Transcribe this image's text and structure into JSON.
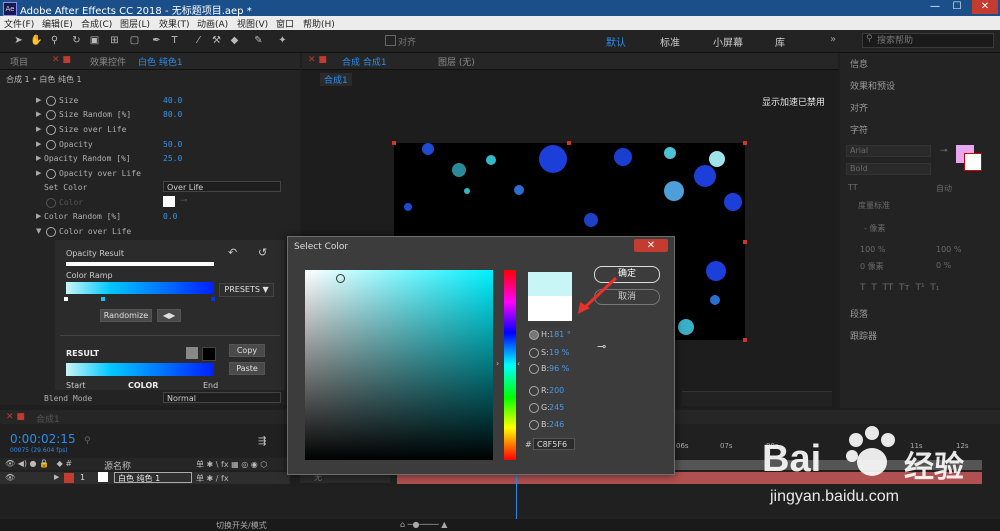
{
  "titlebar": {
    "logo": "Ae",
    "title": "Adobe After Effects CC 2018 - 无标题项目.aep *",
    "min": "—",
    "max": "☐",
    "close": "✕"
  },
  "menubar": {
    "items": [
      "文件(F)",
      "编辑(E)",
      "合成(C)",
      "图层(L)",
      "效果(T)",
      "动画(A)",
      "视图(V)",
      "窗口",
      "帮助(H)"
    ]
  },
  "toolbar": {
    "snap_label": "对齐",
    "workspaces": [
      "默认",
      "标准",
      "小屏幕",
      "库"
    ],
    "search_placeholder": "搜索帮助"
  },
  "leftpanel": {
    "tabs": [
      "项目",
      "效果控件",
      "白色 纯色1"
    ],
    "breadcrumb": "合成 1 • 白色 纯色 1",
    "props": [
      {
        "name": "Size",
        "value": "40.0"
      },
      {
        "name": "Size Random [%]",
        "value": "80.0"
      },
      {
        "name": "Size over Life",
        "value": ""
      },
      {
        "name": "Opacity",
        "value": "50.0"
      },
      {
        "name": "Opacity Random [%]",
        "value": "25.0"
      },
      {
        "name": "Opacity over Life",
        "value": ""
      }
    ],
    "set_color_label": "Set Color",
    "set_color_value": "Over Life",
    "color_label": "Color",
    "color_random_label": "Color Random [%]",
    "color_random_value": "0.0",
    "color_over_life": "Color over Life",
    "opacity_result": "Opacity Result",
    "color_ramp": "Color Ramp",
    "presets": "PRESETS",
    "randomize": "Randomize",
    "result": "RESULT",
    "copy": "Copy",
    "paste": "Paste",
    "start": "Start",
    "color": "COLOR",
    "end": "End",
    "blend_mode_label": "Blend Mode",
    "blend_mode_value": "Normal"
  },
  "viewer": {
    "tabs": [
      "合成 合成1",
      "图层 (无)"
    ],
    "subtab": "合成1",
    "gpu_notice": "显示加速已禁用"
  },
  "rightpanel": {
    "sections": [
      "信息",
      "效果和预设",
      "对齐",
      "字符",
      "段落",
      "跟踪器"
    ],
    "font": "Arial",
    "style": "Bold",
    "auto": "自动",
    "metric": "度量标准",
    "pct1": "100 %",
    "pct2": "100 %",
    "px1": "0 像素",
    "pct3": "0 %",
    "px2": "- 像素"
  },
  "timeline": {
    "tab": "合成1",
    "timecode": "0:00:02:15",
    "frames": "00075 (29.604 fps)",
    "col_source": "源名称",
    "layer_index": "1",
    "layer_name": "白色 纯色 1",
    "toggle_mode": "切换开关/模式",
    "ruler": [
      "06s",
      "07s",
      "08s",
      "11s",
      "12s"
    ],
    "none": "无"
  },
  "dialog": {
    "title": "Select Color",
    "close": "✕",
    "ok": "确定",
    "cancel": "取消",
    "h_label": "H:",
    "h_value": "181 °",
    "s_label": "S:",
    "s_value": "19 %",
    "b_label": "B:",
    "b_value": "96 %",
    "r_label": "R:",
    "r_value": "200",
    "g_label": "G:",
    "g_value": "245",
    "bl_label": "B:",
    "bl_value": "246",
    "hex_label": "#",
    "hex_value": "C8F5F6",
    "new_color": "#c8f5f6",
    "current_color": "#ffffff"
  },
  "watermark": {
    "brand": "Bai",
    "brand2": "经验",
    "url": "jingyan.baidu.com"
  },
  "colors": {
    "accent": "#2d8ceb",
    "titlebar": "#1a4f8a",
    "close": "#c43b30"
  }
}
